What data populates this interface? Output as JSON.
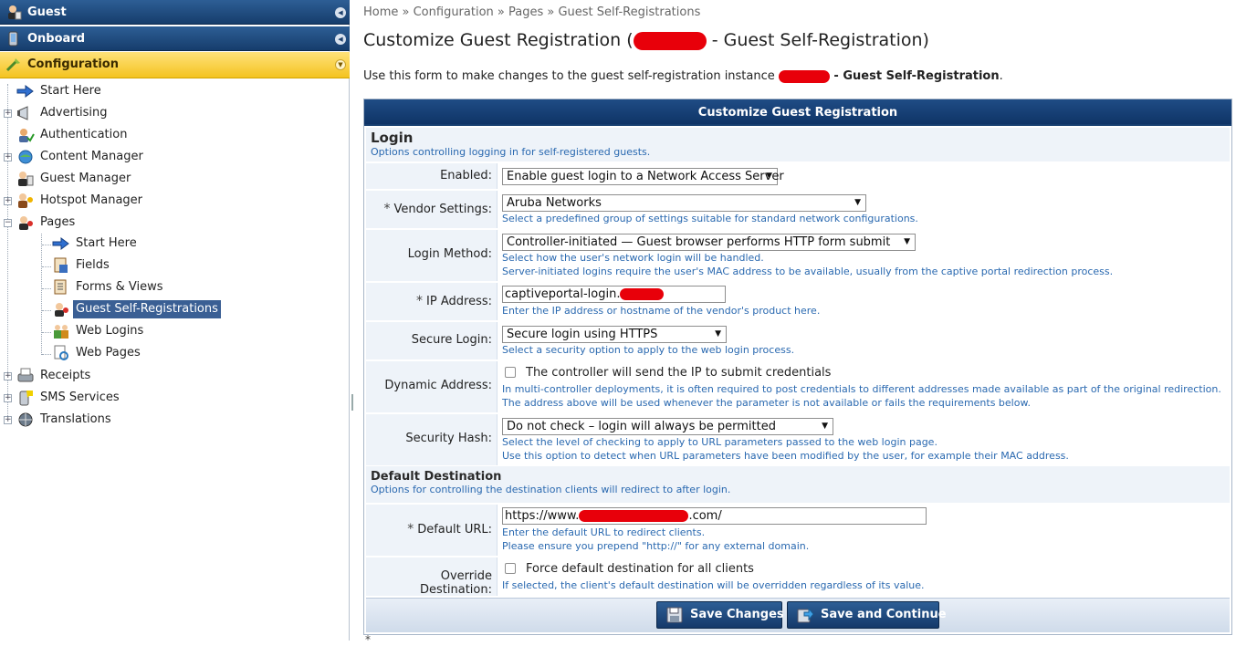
{
  "sidebar": {
    "sections": [
      {
        "label": "Guest",
        "icon": "guest-icon"
      },
      {
        "label": "Onboard",
        "icon": "onboard-icon"
      },
      {
        "label": "Configuration",
        "icon": "configuration-icon"
      }
    ],
    "items": [
      {
        "label": "Start Here",
        "icon": "arrow-right-icon"
      },
      {
        "label": "Advertising",
        "icon": "megaphone-icon"
      },
      {
        "label": "Authentication",
        "icon": "authentication-icon"
      },
      {
        "label": "Content Manager",
        "icon": "content-manager-icon"
      },
      {
        "label": "Guest Manager",
        "icon": "guest-manager-icon"
      },
      {
        "label": "Hotspot Manager",
        "icon": "hotspot-manager-icon"
      },
      {
        "label": "Pages",
        "icon": "pages-icon"
      },
      {
        "label": "Receipts",
        "icon": "receipts-icon"
      },
      {
        "label": "SMS Services",
        "icon": "sms-icon"
      },
      {
        "label": "Translations",
        "icon": "translations-icon"
      }
    ],
    "pages_children": [
      {
        "label": "Start Here",
        "icon": "arrow-right-icon"
      },
      {
        "label": "Fields",
        "icon": "fields-icon"
      },
      {
        "label": "Forms & Views",
        "icon": "forms-views-icon"
      },
      {
        "label": "Guest Self-Registrations",
        "icon": "guest-self-registration-icon"
      },
      {
        "label": "Web Logins",
        "icon": "web-logins-icon"
      },
      {
        "label": "Web Pages",
        "icon": "web-pages-icon"
      }
    ]
  },
  "breadcrumb": "Home » Configuration » Pages » Guest Self-Registrations",
  "title": {
    "prefix": "Customize Guest Registration (",
    "suffix": " - Guest Self-Registration)"
  },
  "intro": {
    "text": "Use this form to make changes to the guest self-registration instance ",
    "bold": " - Guest Self-Registration",
    "end": "."
  },
  "form": {
    "header": "Customize Guest Registration",
    "login_section": {
      "title": "Login",
      "desc": "Options controlling logging in for self-registered guests."
    },
    "enabled": {
      "label": "Enabled:",
      "value": "Enable guest login to a Network Access Server"
    },
    "vendor": {
      "label": "Vendor Settings:",
      "value": "Aruba Networks",
      "hint": "Select a predefined group of settings suitable for standard network configurations."
    },
    "login_method": {
      "label": "Login Method:",
      "value": "Controller-initiated — Guest browser performs HTTP form submit",
      "hint1": "Select how the user's network login will be handled.",
      "hint2": "Server-initiated logins require the user's MAC address to be available, usually from the captive portal redirection process."
    },
    "ip_address": {
      "label": "IP Address:",
      "value": "captiveportal-login.",
      "hint": "Enter the IP address or hostname of the vendor's product here."
    },
    "secure_login": {
      "label": "Secure Login:",
      "value": "Secure login using HTTPS",
      "hint": "Select a security option to apply to the web login process."
    },
    "dynamic_address": {
      "label": "Dynamic Address:",
      "checkbox_label": "The controller will send the IP to submit credentials",
      "hint1": "In multi-controller deployments, it is often required to post credentials to different addresses made available as part of the original redirection.",
      "hint2": "The address above will be used whenever the parameter is not available or fails the requirements below."
    },
    "security_hash": {
      "label": "Security Hash:",
      "value": "Do not check – login will always be permitted",
      "hint1": "Select the level of checking to apply to URL parameters passed to the web login page.",
      "hint2": "Use this option to detect when URL parameters have been modified by the user, for example their MAC address."
    },
    "dest_section": {
      "title": "Default Destination",
      "desc": "Options for controlling the destination clients will redirect to after login."
    },
    "default_url": {
      "label": "Default URL:",
      "prefix": "https://www.",
      "suffix": ".com/",
      "hint1": "Enter the default URL to redirect clients.",
      "hint2": "Please ensure you prepend \"http://\" for any external domain."
    },
    "override": {
      "label": "Override Destination:",
      "checkbox_label": "Force default destination for all clients",
      "hint": "If selected, the client's default destination will be overridden regardless of its value."
    },
    "required_mark": "*",
    "buttons": {
      "save": "Save Changes",
      "save_continue": "Save and Continue"
    }
  },
  "colors": {
    "nav_blue": "#163d6c",
    "active_yellow": "#f4c320",
    "hint_blue": "#2a69b0",
    "redaction": "#e8000a"
  }
}
